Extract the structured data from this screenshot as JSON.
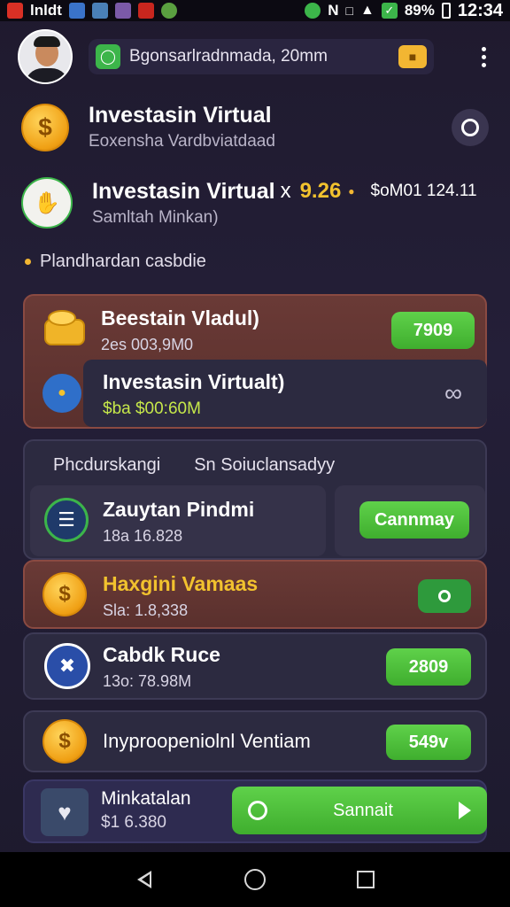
{
  "status_bar": {
    "left_text": "lnldt",
    "n_mark": "N",
    "battery": "89%",
    "time": "12:34"
  },
  "header": {
    "pill_text": "Bgonsarlradnmada, 20mm"
  },
  "profile_row_1": {
    "title": "Investasin Virtual",
    "subtitle": "Eoxensha Vardbviatdaad"
  },
  "profile_row_2": {
    "title": "Investasin Virtual",
    "multiplier": "x",
    "value": "9.26",
    "amount": "$oM01 124.11",
    "subtitle": "Samltah Minkan)"
  },
  "bullet_text": "Plandhardan casbdie",
  "card_1": {
    "title": "Beestain Vladul)",
    "subtitle": "2es 003,9M0",
    "button_label": "7909"
  },
  "card_1_inner": {
    "title": "Investasin Virtualt)",
    "subtitle": "$ba $00:60M"
  },
  "tabs": [
    "Phcdurskangi",
    "Sn Soiuclansadyy"
  ],
  "card_2_item": {
    "title": "Zauytan Pindmi",
    "subtitle": "18a 16.828",
    "button_label": "Cannmay"
  },
  "card_3": {
    "title": "Haxgini Vamaas",
    "subtitle": "Sla: 1.8,338"
  },
  "card_4": {
    "title": "Cabdk Ruce",
    "subtitle": "13o: 78.98M",
    "button_label": "2809"
  },
  "card_5": {
    "title": "Inyproopeniolnl Ventiam",
    "button_label": "549v"
  },
  "card_6": {
    "title": "Minkatalan",
    "subtitle": "$1 6.380",
    "button_label": "Sannait"
  },
  "colors": {
    "accent_green": "#4fc23b",
    "coin_gold": "#f0a014",
    "card_red": "#5a302d",
    "background": "#221d33"
  },
  "icons": {
    "coin": "dollar-coin-icon",
    "search": "search-icon",
    "lock": "lock-icon",
    "menu": "more-vertical-icon",
    "play": "play-icon"
  }
}
